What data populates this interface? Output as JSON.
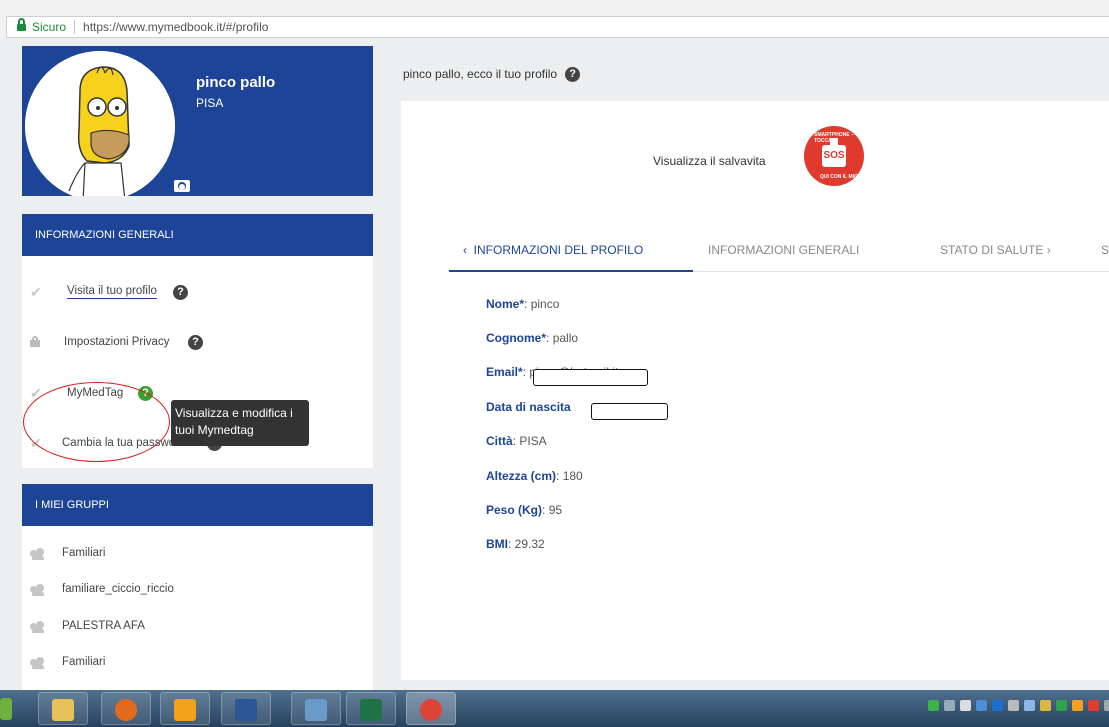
{
  "browser": {
    "secure_label": "Sicuro",
    "url": "https://www.mymedbook.it/#/profilo"
  },
  "profile": {
    "name": "pinco pallo",
    "city": "PISA"
  },
  "general_info": {
    "header": "INFORMAZIONI GENERALI",
    "items": [
      {
        "label": "Visita il tuo profilo",
        "icon": "check-icon"
      },
      {
        "label": "Impostazioni Privacy",
        "icon": "lock-icon"
      },
      {
        "label": "MyMedTag",
        "icon": "check-icon"
      },
      {
        "label": "Cambia la tua password",
        "icon": "check-icon"
      }
    ],
    "tooltip": "Visualizza e modifica i tuoi Mymedtag"
  },
  "groups": {
    "header": "I MIEI GRUPPI",
    "items": [
      "Familiari",
      "familiare_ciccio_riccio",
      "PALESTRA AFA",
      "Familiari"
    ]
  },
  "main": {
    "header": "pinco pallo, ecco il tuo profilo",
    "lifesaver_label": "Visualizza il salvavita",
    "sos_logo_text": "SOS",
    "sos_arc_top": "SMARTPHONE – TOCCA",
    "sos_arc_bottom": "QUI CON IL MIO",
    "tabs": [
      {
        "label": "INFORMAZIONI DEL PROFILO",
        "active": true
      },
      {
        "label": "INFORMAZIONI GENERALI",
        "active": false
      },
      {
        "label": "STATO DI SALUTE",
        "active": false
      },
      {
        "label": "S",
        "active": false
      }
    ],
    "fields": [
      {
        "label": "Nome",
        "required": "*",
        "value": "pinco"
      },
      {
        "label": "Cognome",
        "required": "*",
        "value": "pallo"
      },
      {
        "label": "Email",
        "required": "*",
        "value": "pinco@hotmail.it"
      },
      {
        "label": "Data di nascita",
        "required": "",
        "value": ""
      },
      {
        "label": "Città",
        "required": "",
        "value": "PISA"
      },
      {
        "label": "Altezza (cm)",
        "required": "",
        "value": "180"
      },
      {
        "label": "Peso (Kg)",
        "required": "",
        "value": "95"
      },
      {
        "label": "BMI",
        "required": "",
        "value": "29.32"
      }
    ]
  },
  "colors": {
    "brand_blue": "#1d4497",
    "annotation_red": "#d21a1a",
    "help_green": "#3aa12f"
  }
}
